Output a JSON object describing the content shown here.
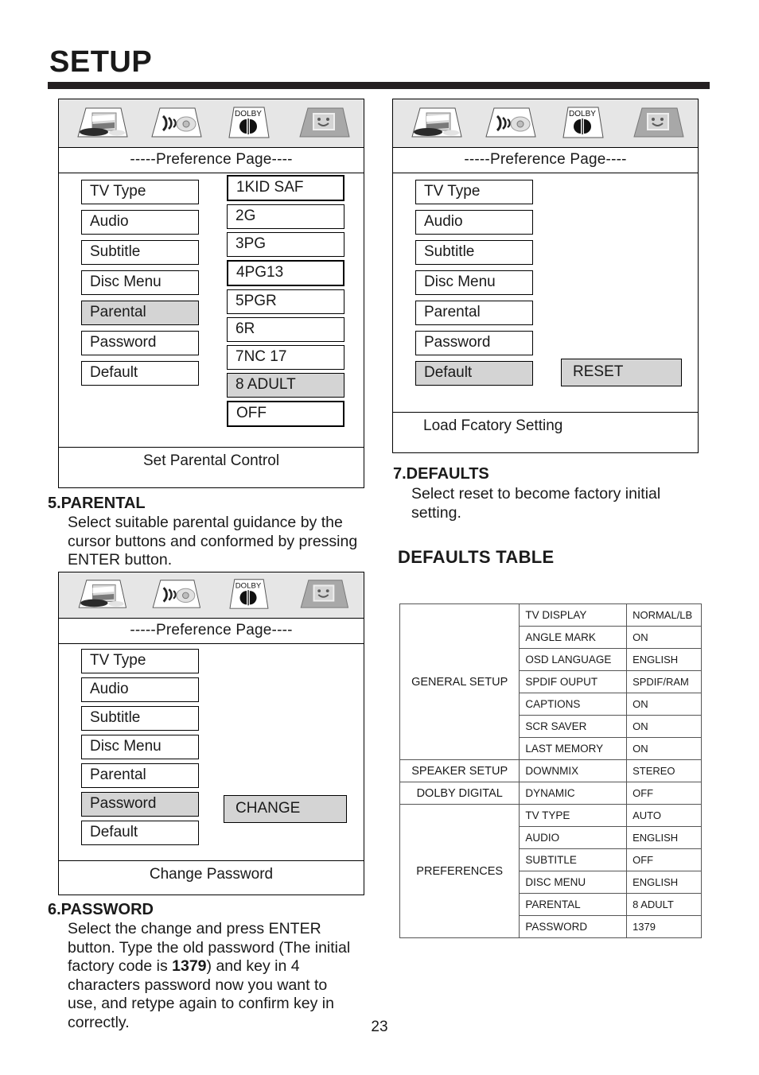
{
  "page": {
    "title": "SETUP",
    "number": "23"
  },
  "icons": {
    "general_setup": "tv-monitor-icon",
    "speaker_setup": "speaker-icon",
    "dolby_digital": "dolby-icon",
    "preferences": "preferences-face-icon",
    "dolby_label": "DOLBY"
  },
  "panels": {
    "parental": {
      "title": "-----Preference Page----",
      "footer": "Set Parental Control",
      "menu": [
        {
          "label": "TV Type",
          "selected": false
        },
        {
          "label": "Audio",
          "selected": false
        },
        {
          "label": "Subtitle",
          "selected": false
        },
        {
          "label": "Disc Menu",
          "selected": false
        },
        {
          "label": "Parental",
          "selected": true
        },
        {
          "label": "Password",
          "selected": false
        },
        {
          "label": "Default",
          "selected": false
        }
      ],
      "options": [
        {
          "label": "1KID SAF",
          "selected": false
        },
        {
          "label": "2G",
          "selected": false
        },
        {
          "label": "3PG",
          "selected": false
        },
        {
          "label": "4PG13",
          "selected": false
        },
        {
          "label": "5PGR",
          "selected": false
        },
        {
          "label": "6R",
          "selected": false
        },
        {
          "label": "7NC 17",
          "selected": false
        },
        {
          "label": "8 ADULT",
          "selected": true
        },
        {
          "label": "OFF",
          "selected": false
        }
      ]
    },
    "defaults": {
      "title": "-----Preference Page----",
      "footer": "Load Fcatory  Setting",
      "menu": [
        {
          "label": "TV Type",
          "selected": false
        },
        {
          "label": "Audio",
          "selected": false
        },
        {
          "label": "Subtitle",
          "selected": false
        },
        {
          "label": "Disc Menu",
          "selected": false
        },
        {
          "label": "Parental",
          "selected": false
        },
        {
          "label": "Password",
          "selected": false
        },
        {
          "label": "Default",
          "selected": true
        }
      ],
      "action": "RESET"
    },
    "password": {
      "title": "-----Preference Page----",
      "footer": "Change Password",
      "menu": [
        {
          "label": "TV Type",
          "selected": false
        },
        {
          "label": "Audio",
          "selected": false
        },
        {
          "label": "Subtitle",
          "selected": false
        },
        {
          "label": "Disc Menu",
          "selected": false
        },
        {
          "label": "Parental",
          "selected": false
        },
        {
          "label": "Password",
          "selected": true
        },
        {
          "label": "Default",
          "selected": false
        }
      ],
      "action": "CHANGE"
    }
  },
  "sections": {
    "parental": {
      "heading": "5.PARENTAL",
      "body": "Select suitable parental guidance by the cursor buttons and conformed by pressing ENTER button."
    },
    "password": {
      "heading": "6.PASSWORD",
      "body_part1": "Select the change and press ENTER button.  Type the old password (The initial factory code is ",
      "body_code": "1379",
      "body_part2": ") and key in 4 characters password now you want to use, and retype again to confirm key in correctly."
    },
    "defaults": {
      "heading": "7.DEFAULTS",
      "body": "Select reset to become factory initial setting."
    },
    "defaults_table_heading": "DEFAULTS TABLE"
  },
  "defaults_table": {
    "groups": [
      {
        "name": "GENERAL SETUP",
        "rows": [
          {
            "key": "TV DISPLAY",
            "value": "NORMAL/LB"
          },
          {
            "key": "ANGLE MARK",
            "value": "ON"
          },
          {
            "key": "OSD LANGUAGE",
            "value": "ENGLISH"
          },
          {
            "key": "SPDIF OUPUT",
            "value": "SPDIF/RAM"
          },
          {
            "key": "CAPTIONS",
            "value": "ON"
          },
          {
            "key": "SCR SAVER",
            "value": "ON"
          },
          {
            "key": "LAST MEMORY",
            "value": "ON"
          }
        ]
      },
      {
        "name": "SPEAKER SETUP",
        "rows": [
          {
            "key": "DOWNMIX",
            "value": "STEREO"
          }
        ]
      },
      {
        "name": "DOLBY DIGITAL",
        "rows": [
          {
            "key": "DYNAMIC",
            "value": "OFF"
          }
        ]
      },
      {
        "name": "PREFERENCES",
        "rows": [
          {
            "key": "TV TYPE",
            "value": "AUTO"
          },
          {
            "key": "AUDIO",
            "value": "ENGLISH"
          },
          {
            "key": "SUBTITLE",
            "value": "OFF"
          },
          {
            "key": "DISC MENU",
            "value": "ENGLISH"
          },
          {
            "key": "PARENTAL",
            "value": "8  ADULT"
          },
          {
            "key": "PASSWORD",
            "value": "1379"
          }
        ]
      }
    ]
  },
  "colors": {
    "selected_bg": "#d4d4d4",
    "iconbar_bg": "#e6e6e6",
    "rule": "#231f20"
  }
}
